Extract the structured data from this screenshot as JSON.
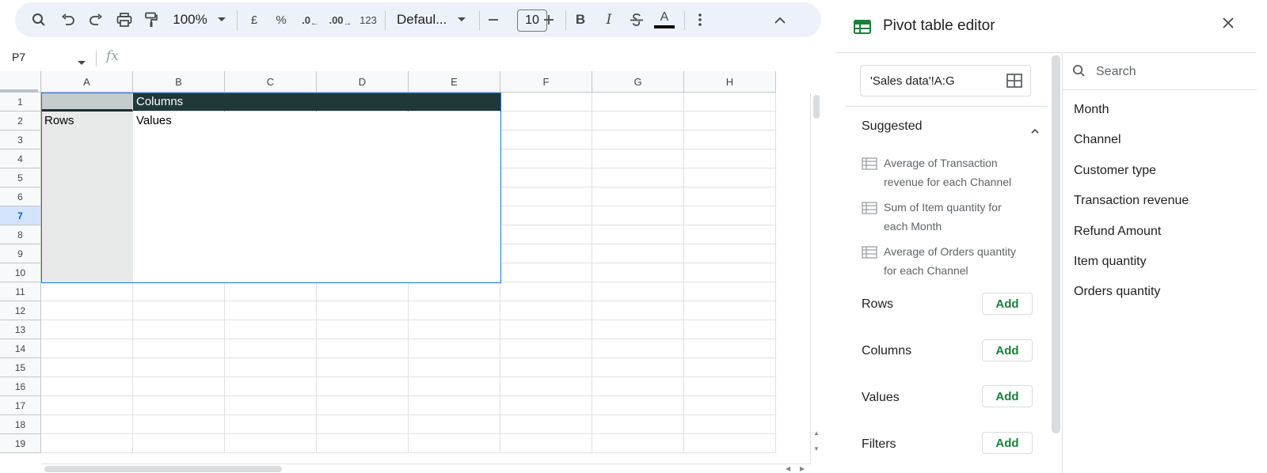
{
  "toolbar": {
    "zoom": "100%",
    "currency": "£",
    "percent": "%",
    "decrease_decimal": ".0",
    "increase_decimal": ".00",
    "number_format": "123",
    "font": "Defaul...",
    "font_size": "10",
    "text_color": "#000000"
  },
  "formula_bar": {
    "cell_ref": "P7",
    "fx": "fx"
  },
  "sheet": {
    "columns": [
      "A",
      "B",
      "C",
      "D",
      "E",
      "F",
      "G",
      "H"
    ],
    "rows": [
      "1",
      "2",
      "3",
      "4",
      "5",
      "6",
      "7",
      "8",
      "9",
      "10",
      "11",
      "12",
      "13",
      "14",
      "15",
      "16",
      "17",
      "18",
      "19"
    ],
    "selected_row": "7",
    "pivot": {
      "columns_label": "Columns",
      "rows_label": "Rows",
      "values_label": "Values",
      "header_color": "#203838"
    }
  },
  "panel": {
    "title": "Pivot table editor",
    "range": "'Sales data'!A:G",
    "suggested_heading": "Suggested",
    "suggestions": [
      "Average of Transaction revenue for each Channel",
      "Sum of Item quantity for each Month",
      "Average of Orders quantity for each Channel"
    ],
    "sections": [
      {
        "label": "Rows",
        "button": "Add"
      },
      {
        "label": "Columns",
        "button": "Add"
      },
      {
        "label": "Values",
        "button": "Add"
      },
      {
        "label": "Filters",
        "button": "Add"
      }
    ],
    "search_placeholder": "Search",
    "fields": [
      "Month",
      "Channel",
      "Customer type",
      "Transaction revenue",
      "Refund Amount",
      "Item quantity",
      "Orders quantity"
    ],
    "accent_color": "#188038"
  }
}
